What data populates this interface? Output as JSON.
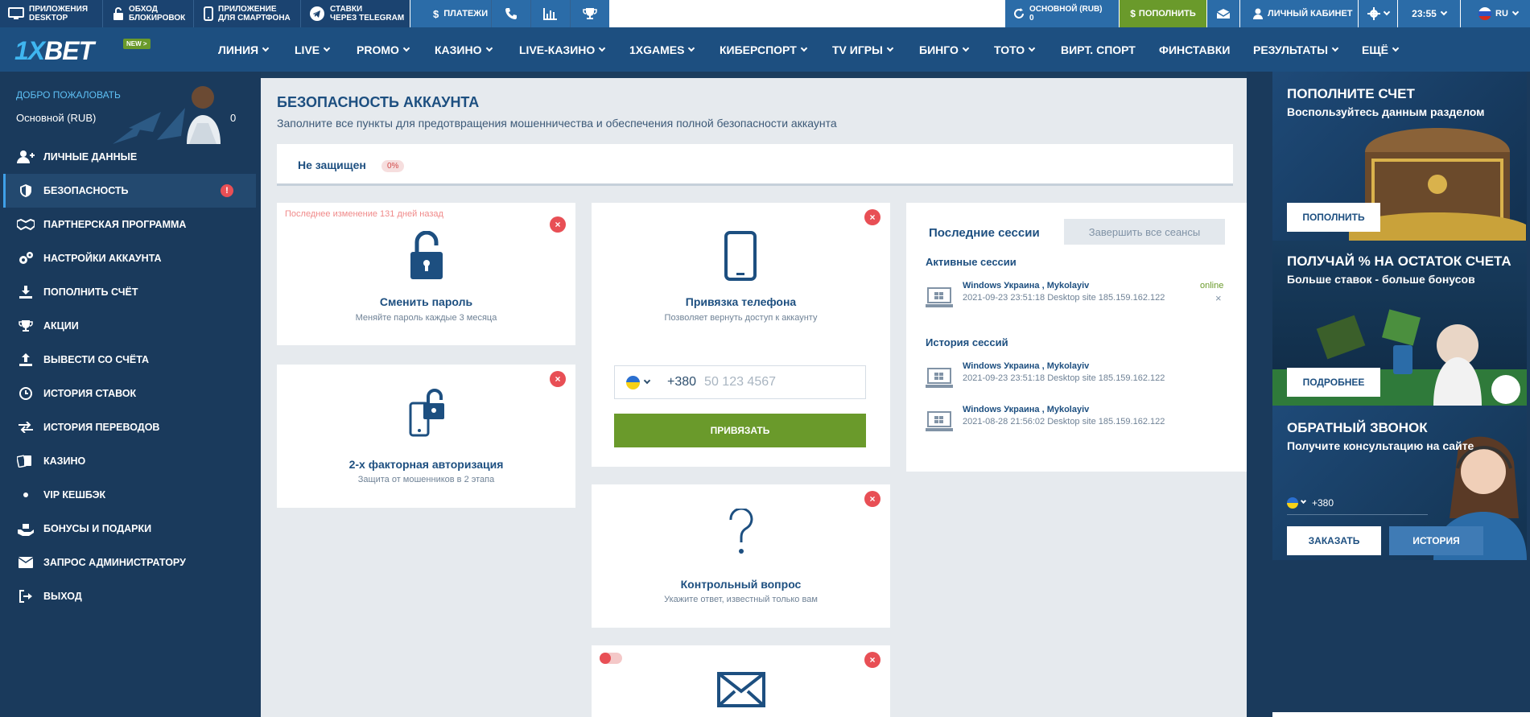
{
  "topbar": {
    "desktop_app": [
      "ПРИЛОЖЕНИЯ",
      "DESKTOP"
    ],
    "bypass": [
      "ОБХОД",
      "БЛОКИРОВОК"
    ],
    "smartphone_app": [
      "ПРИЛОЖЕНИЕ",
      "ДЛЯ СМАРТФОНА"
    ],
    "telegram": [
      "СТАВКИ",
      "ЧЕРЕЗ TELEGRAM"
    ],
    "payments": "ПЛАТЕЖИ",
    "balance_label": "ОСНОВНОЙ (RUB)",
    "balance_value": "0",
    "deposit": "ПОПОЛНИТЬ",
    "cabinet": "ЛИЧНЫЙ КАБИНЕТ",
    "time": "23:55",
    "lang": "RU"
  },
  "nav": {
    "logo_one": "1X",
    "logo_bet": "BET",
    "new_badge": "NEW >",
    "items": [
      "ЛИНИЯ",
      "LIVE",
      "PROMO",
      "КАЗИНО",
      "LIVE-КАЗИНО",
      "1XGAMES",
      "КИБЕРСПОРТ",
      "TV ИГРЫ",
      "БИНГО",
      "ТОТО",
      "ВИРТ. СПОРТ",
      "ФИНСТАВКИ",
      "РЕЗУЛЬТАТЫ",
      "ЕЩЁ"
    ]
  },
  "sidebar": {
    "welcome": "ДОБРО ПОЖАЛОВАТЬ",
    "account": "Основной (RUB)",
    "balance": "0",
    "items": [
      {
        "label": "ЛИЧНЫЕ ДАННЫЕ",
        "icon": "user-plus-icon"
      },
      {
        "label": "БЕЗОПАСНОСТЬ",
        "icon": "shield-icon"
      },
      {
        "label": "ПАРТНЕРСКАЯ ПРОГРАММА",
        "icon": "handshake-icon"
      },
      {
        "label": "НАСТРОЙКИ АККАУНТА",
        "icon": "gears-icon"
      },
      {
        "label": "ПОПОЛНИТЬ СЧЁТ",
        "icon": "download-icon"
      },
      {
        "label": "АКЦИИ",
        "icon": "trophy-icon"
      },
      {
        "label": "ВЫВЕСТИ СО СЧЁТА",
        "icon": "upload-icon"
      },
      {
        "label": "ИСТОРИЯ СТАВОК",
        "icon": "clock-icon"
      },
      {
        "label": "ИСТОРИЯ ПЕРЕВОДОВ",
        "icon": "transfer-icon"
      },
      {
        "label": "КАЗИНО",
        "icon": "cards-icon"
      },
      {
        "label": "VIP КЕШБЭК",
        "icon": "dot-icon"
      },
      {
        "label": "БОНУСЫ И ПОДАРКИ",
        "icon": "gift-icon"
      },
      {
        "label": "ЗАПРОС АДМИНИСТРАТОРУ",
        "icon": "mail-icon"
      },
      {
        "label": "ВЫХОД",
        "icon": "logout-icon"
      }
    ],
    "alert_mark": "!"
  },
  "main": {
    "title": "БЕЗОПАСНОСТЬ АККАУНТА",
    "subtitle": "Заполните все пункты для предотвращения мошенничества и обеспечения полной безопасности аккаунта",
    "status": "Не защищен",
    "status_percent": "0%",
    "password": {
      "last_change": "Последнее изменение 131 дней назад",
      "title": "Сменить пароль",
      "subtitle": "Меняйте пароль каждые 3 месяца"
    },
    "twofa": {
      "title": "2-х факторная авторизация",
      "subtitle": "Защита от мошенников в 2 этапа"
    },
    "phone": {
      "title": "Привязка телефона",
      "subtitle": "Позволяет вернуть доступ к аккаунту",
      "code": "+380",
      "placeholder": "50 123 4567",
      "button": "ПРИВЯЗАТЬ"
    },
    "question": {
      "title": "Контрольный вопрос",
      "subtitle": "Укажите ответ, известный только вам"
    },
    "sessions": {
      "title": "Последние сессии",
      "end_all": "Завершить все сеансы",
      "active_title": "Активные сессии",
      "history_title": "История сессий",
      "online": "online",
      "close": "×",
      "active": [
        {
          "name": "Windows Украина , Mykolayiv",
          "details": "2021-09-23 23:51:18 Desktop site 185.159.162.122"
        }
      ],
      "history": [
        {
          "name": "Windows Украина , Mykolayiv",
          "details": "2021-09-23 23:51:18 Desktop site 185.159.162.122"
        },
        {
          "name": "Windows Украина , Mykolayiv",
          "details": "2021-08-28 21:56:02 Desktop site 185.159.162.122"
        }
      ]
    },
    "close_mark": "×"
  },
  "right": {
    "promo1": {
      "title": "ПОПОЛНИТЕ СЧЕТ",
      "subtitle": "Воспользуйтесь данным разделом",
      "button": "ПОПОЛНИТЬ"
    },
    "promo2": {
      "title": "ПОЛУЧАЙ % НА ОСТАТОК СЧЕТА",
      "subtitle": "Больше ставок - больше бонусов",
      "button": "ПОДРОБНЕЕ"
    },
    "promo3": {
      "title": "ОБРАТНЫЙ ЗВОНОК",
      "subtitle": "Получите консультацию на сайте",
      "code": "+380",
      "order": "ЗАКАЗАТЬ",
      "history": "ИСТОРИЯ"
    }
  }
}
